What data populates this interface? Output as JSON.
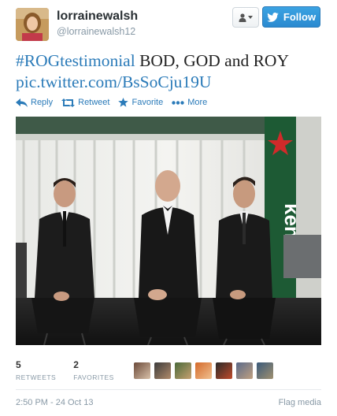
{
  "user": {
    "display_name": "lorrainewalsh",
    "handle": "@lorrainewalsh12"
  },
  "buttons": {
    "follow_label": "Follow"
  },
  "tweet": {
    "hashtag": "#ROGtestimonial",
    "text": " BOD, GOD and ROY",
    "pic_link": "pic.twitter.com/BsSoCju19U"
  },
  "actions": {
    "reply": "Reply",
    "retweet": "Retweet",
    "favorite": "Favorite",
    "more": "More"
  },
  "stats": {
    "retweets_count": "5",
    "retweets_label": "RETWEETS",
    "favorites_count": "2",
    "favorites_label": "FAVORITES"
  },
  "footer": {
    "timestamp": "2:50 PM - 24 Oct 13",
    "flag_media": "Flag media"
  },
  "media": {
    "banner_text": "ken"
  },
  "colors": {
    "link": "#2b7bb9",
    "follow_button": "#2a8ad0",
    "muted": "#8899a6"
  }
}
